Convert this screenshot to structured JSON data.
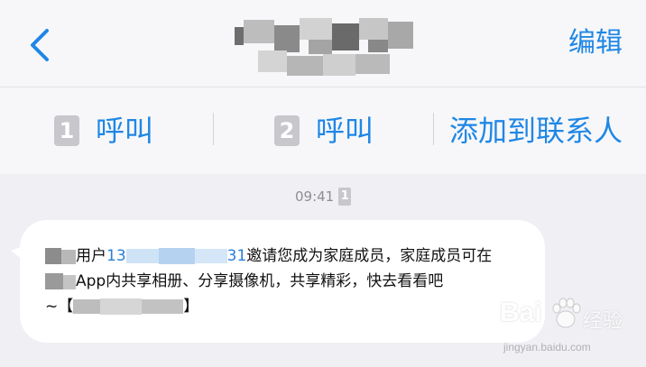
{
  "header": {
    "back_icon": "chevron-left-icon",
    "contact_name": "",
    "edit_label": "编辑"
  },
  "actions": {
    "call1_sim": "1",
    "call1_label": "呼叫",
    "call2_sim": "2",
    "call2_label": "呼叫",
    "add_contact_label": "添加到联系人"
  },
  "message": {
    "time": "09:41",
    "sim_badge": "1",
    "user_prefix": "用户",
    "phone_start": "13",
    "phone_end": "31",
    "line1_rest": "邀请您成为家庭成员，家庭成员可在",
    "line2": "App内共享相册、分享摄像机，共享精彩，快去看看吧",
    "line3_prefix": "~【",
    "line3_suffix": "】"
  },
  "watermark": {
    "brand": "Bai",
    "brand_cn": "经验",
    "url": "jingyan.baidu.com"
  },
  "colors": {
    "accent": "#1f87e5",
    "background": "#efeff4",
    "bubble": "#ffffff"
  }
}
